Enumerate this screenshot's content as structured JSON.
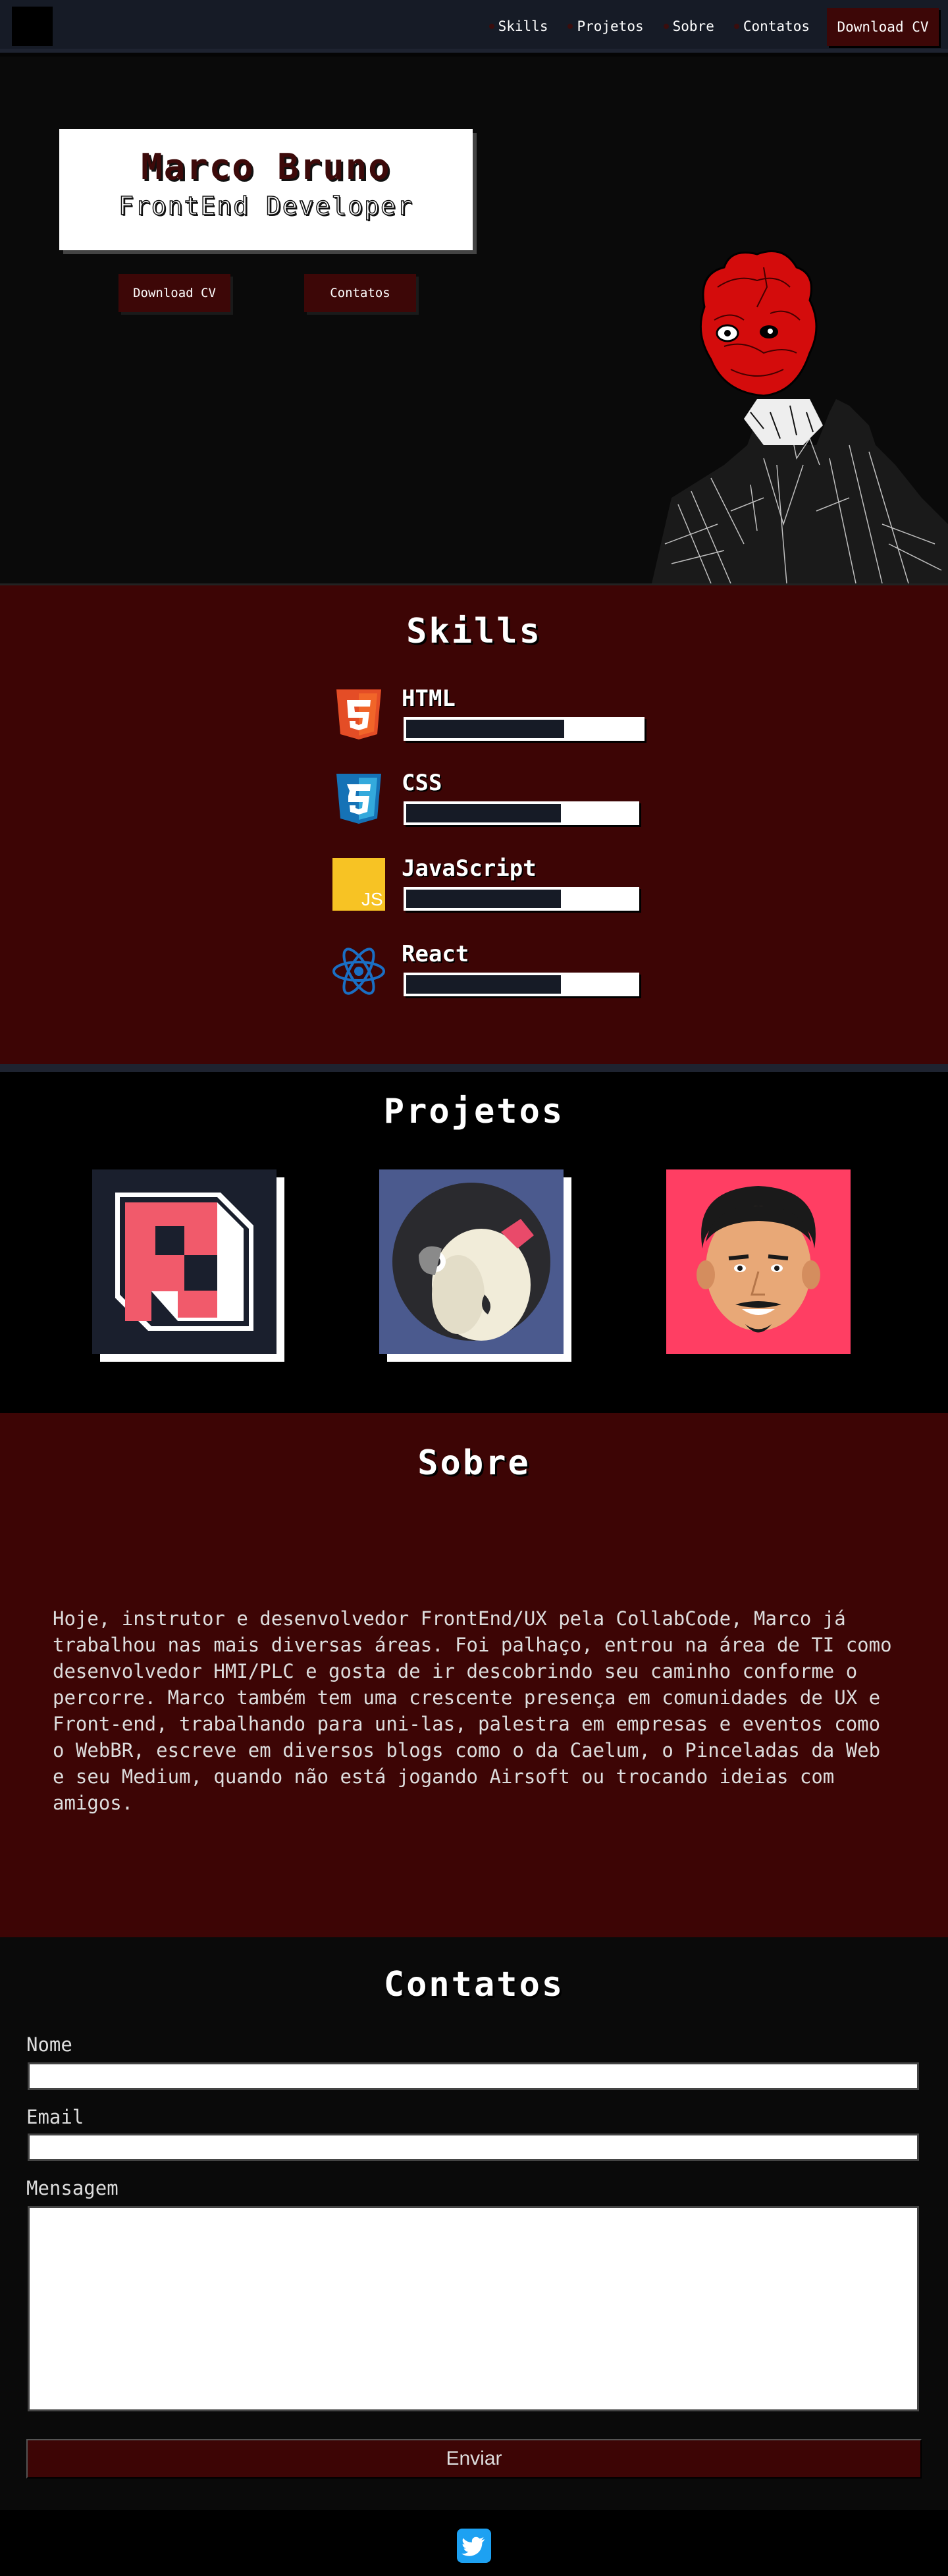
{
  "nav": {
    "links": [
      "Skills",
      "Projetos",
      "Sobre",
      "Contatos"
    ],
    "cta": "Download CV"
  },
  "hero": {
    "name": "Marco Bruno",
    "role": "FrontEnd Developer",
    "btn_cv": "Download CV",
    "btn_contact": "Contatos"
  },
  "skills": {
    "title": "Skills",
    "items": [
      {
        "name": "HTML",
        "icon": "html5-icon",
        "level": 0.33
      },
      {
        "name": "CSS",
        "icon": "css3-icon",
        "level": 0.33
      },
      {
        "name": "JavaScript",
        "icon": "javascript-icon",
        "level": 0.33
      },
      {
        "name": "React",
        "icon": "react-icon",
        "level": 0.33
      }
    ]
  },
  "projetos": {
    "title": "Projetos",
    "items": [
      "fernando-logo",
      "penguin-avatar",
      "caricature-avatar"
    ]
  },
  "sobre": {
    "title": "Sobre",
    "text": "Hoje, instrutor e desenvolvedor FrontEnd/UX pela CollabCode, Marco já trabalhou nas mais diversas áreas. Foi palhaço, entrou na área de TI como desenvolvedor HMI/PLC e gosta de ir descobrindo seu caminho conforme o percorre. Marco também tem uma crescente presença em comunidades de UX e Front-end, trabalhando para uni-las, palestra em empresas e eventos como o WebBR, escreve em diversos blogs como o da Caelum, o Pinceladas da Web e seu Medium, quando não está jogando Airsoft ou trocando ideias com amigos."
  },
  "contatos": {
    "title": "Contatos",
    "label_nome": "Nome",
    "label_email": "Email",
    "label_msg": "Mensagem",
    "send": "Enviar"
  },
  "footer": {
    "icon": "twitter-icon"
  },
  "colors": {
    "accent": "#3d0505",
    "nav_bg": "#161b26",
    "button": "#3d0707"
  }
}
